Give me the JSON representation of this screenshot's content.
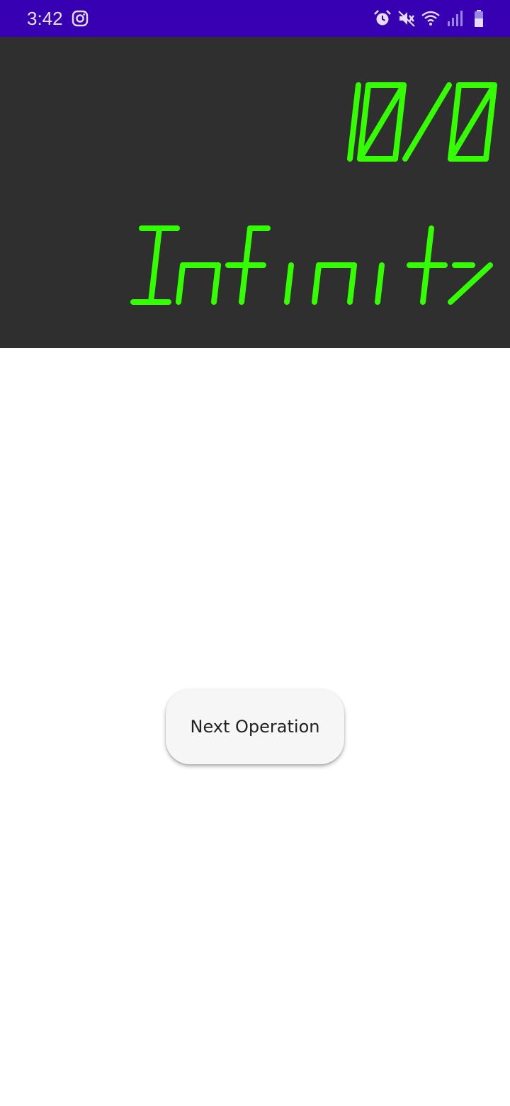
{
  "status_bar": {
    "time": "3:42",
    "icons": [
      "instagram-icon",
      "alarm-icon",
      "mute-icon",
      "wifi-icon",
      "signal-icon",
      "battery-icon"
    ],
    "background": "#3700b3"
  },
  "display": {
    "expression": "10/0",
    "result": "Infinity",
    "background": "#2f2f2f",
    "digit_color": "#33ff00"
  },
  "actions": {
    "next_label": "Next Operation"
  }
}
